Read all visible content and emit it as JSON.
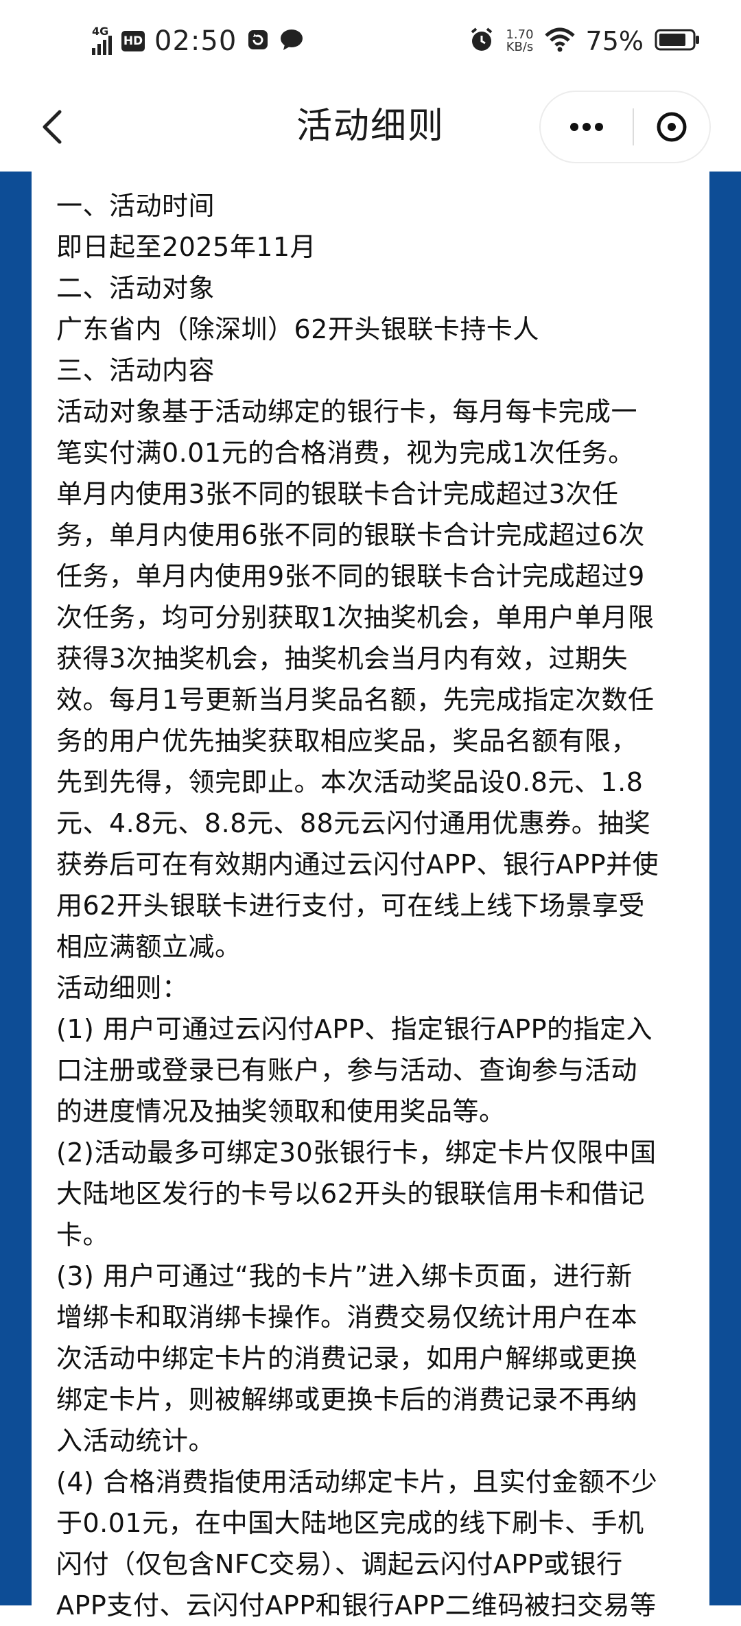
{
  "status_bar": {
    "network": "4G",
    "hd_badge": "HD",
    "time": "02:50",
    "net_speed_value": "1.70",
    "net_speed_unit": "KB/s",
    "battery_percent": "75%"
  },
  "nav": {
    "title": "活动细则"
  },
  "rules": {
    "lines": [
      "一、活动时间",
      "即日起至2025年11月",
      "二、活动对象",
      "广东省内（除深圳）62开头银联卡持卡人",
      "三、活动内容",
      "活动对象基于活动绑定的银行卡，每月每卡完成一",
      "笔实付满0.01元的合格消费，视为完成1次任务。",
      "单月内使用3张不同的银联卡合计完成超过3次任",
      "务，单月内使用6张不同的银联卡合计完成超过6次",
      "任务，单月内使用9张不同的银联卡合计完成超过9",
      "次任务，均可分别获取1次抽奖机会，单用户单月限",
      "获得3次抽奖机会，抽奖机会当月内有效，过期失",
      "效。每月1号更新当月奖品名额，先完成指定次数任",
      "务的用户优先抽奖获取相应奖品，奖品名额有限，",
      "先到先得，领完即止。本次活动奖品设0.8元、1.8",
      "元、4.8元、8.8元、88元云闪付通用优惠券。抽奖",
      "获券后可在有效期内通过云闪付APP、银行APP并使",
      "用62开头银联卡进行支付，可在线上线下场景享受",
      "相应满额立减。",
      "活动细则：",
      "(1) 用户可通过云闪付APP、指定银行APP的指定入",
      "口注册或登录已有账户，参与活动、查询参与活动",
      "的进度情况及抽奖领取和使用奖品等。",
      "(2)活动最多可绑定30张银行卡，绑定卡片仅限中国",
      "大陆地区发行的卡号以62开头的银联信用卡和借记",
      "卡。",
      "(3) 用户可通过“我的卡片”进入绑卡页面，进行新",
      "增绑卡和取消绑卡操作。消费交易仅统计用户在本",
      "次活动中绑定卡片的消费记录，如用户解绑或更换",
      "绑定卡片，则被解绑或更换卡后的消费记录不再纳",
      "入活动统计。",
      "(4) 合格消费指使用活动绑定卡片，且实付金额不少",
      "于0.01元，在中国大陆地区完成的线下刷卡、手机",
      "闪付（仅包含NFC交易）、调起云闪付APP或银行",
      "APP支付、云闪付APP和银行APP二维码被扫交易等"
    ]
  },
  "colors": {
    "page_background_blue": "#0d4d96",
    "card_background": "#ffffff",
    "text": "#111111"
  }
}
